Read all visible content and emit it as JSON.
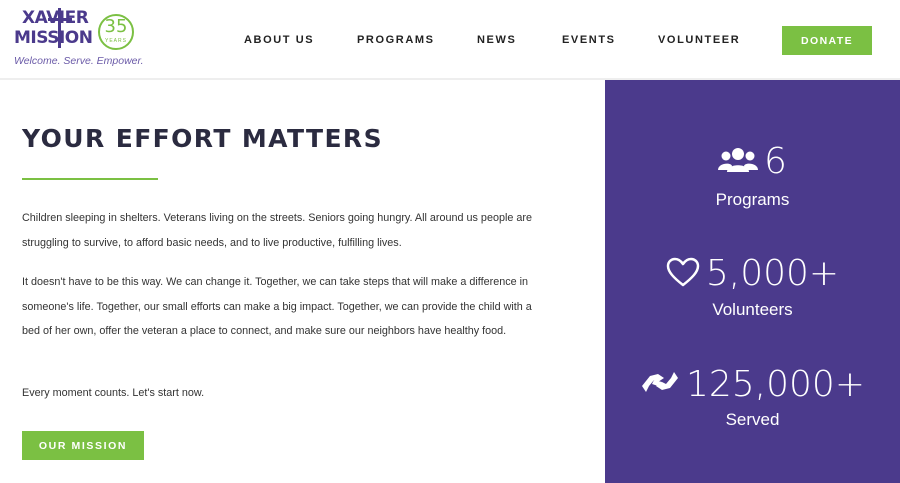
{
  "logo": {
    "word1": "XAVIER",
    "word2": "MISSION",
    "badge_number": "35",
    "badge_caption": "YEARS",
    "tagline": "Welcome. Serve. Empower."
  },
  "nav": {
    "items": [
      "ABOUT US",
      "PROGRAMS",
      "NEWS",
      "EVENTS",
      "VOLUNTEER"
    ],
    "donate_label": "DONATE"
  },
  "main": {
    "title": "YOUR EFFORT MATTERS",
    "paragraph1": "Children sleeping in shelters. Veterans living on the streets. Seniors going hungry. All around us people are struggling to survive, to afford basic needs, and to live productive, fulfilling lives.",
    "paragraph2": "It doesn't have to be this way. We can change it. Together, we can take steps that will make a difference in someone's life. Together, our small efforts can make a big impact. Together, we can provide the child with a bed of her own, offer the veteran a place to connect, and make sure our neighbors have healthy food.",
    "paragraph3": "Every moment counts. Let's start now.",
    "button_label": "OUR MISSION"
  },
  "stats": [
    {
      "icon": "users-icon",
      "value": "6",
      "label": "Programs"
    },
    {
      "icon": "heart-icon",
      "value": "5,000+",
      "label": "Volunteers"
    },
    {
      "icon": "handshake-icon",
      "value": "125,000+",
      "label": "Served"
    }
  ],
  "colors": {
    "brand_purple": "#4b3a8c",
    "accent_green": "#7bc043"
  }
}
